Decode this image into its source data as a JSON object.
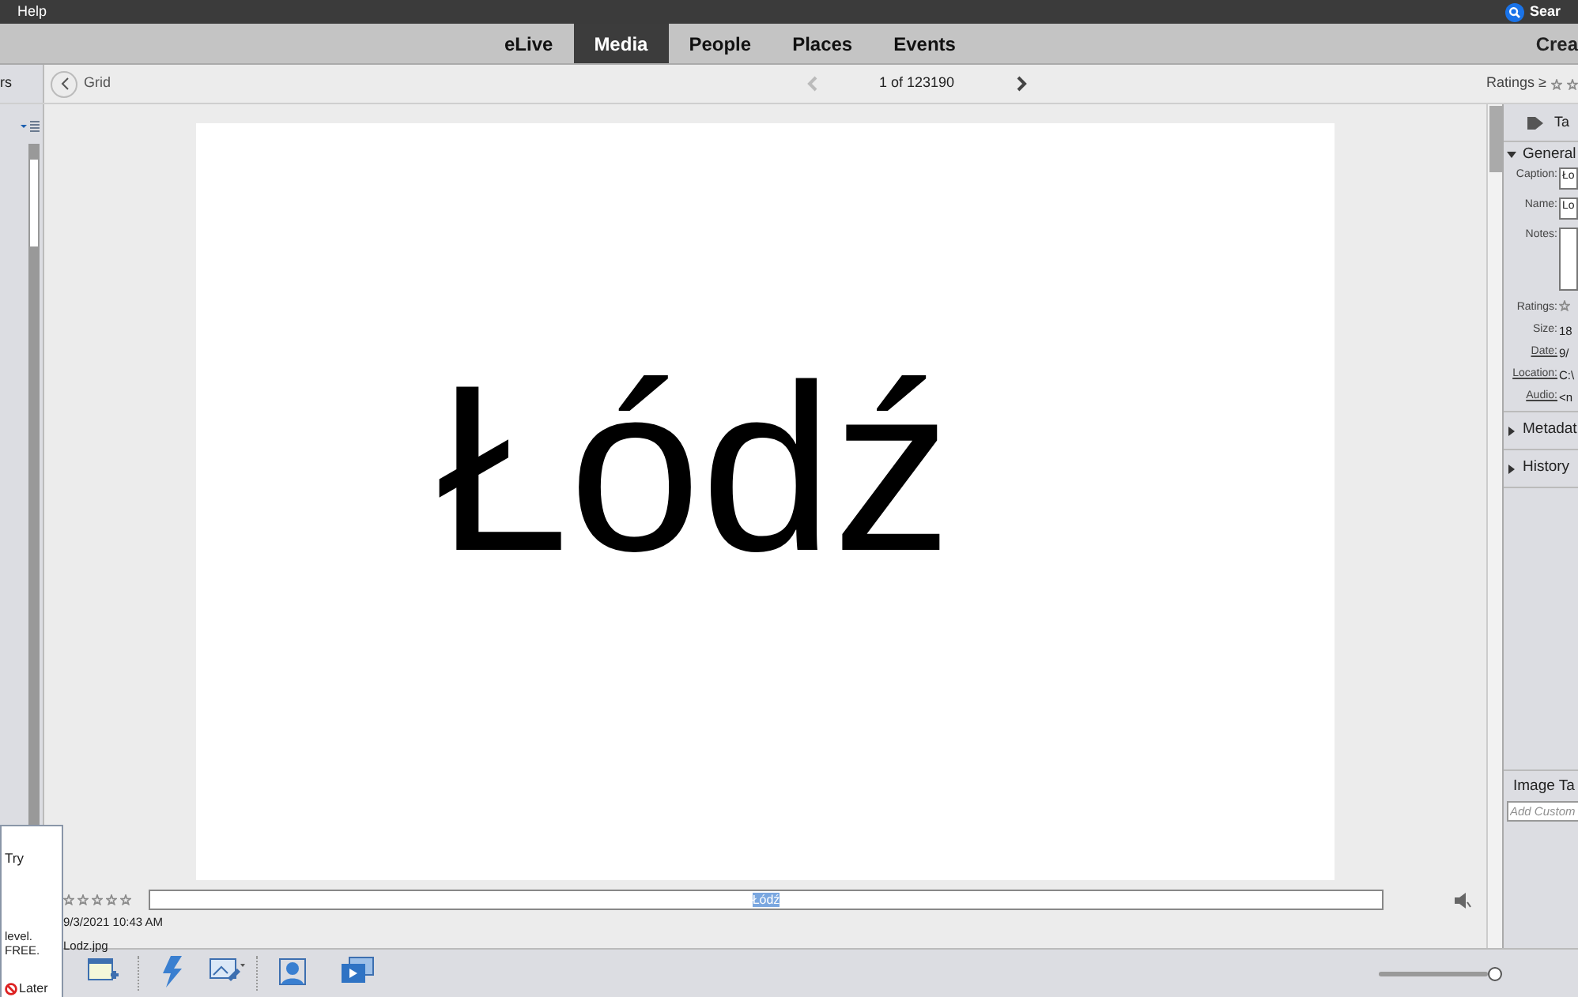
{
  "menu_bar": {
    "items": [
      "Help"
    ],
    "search": "Sear"
  },
  "tabs": [
    {
      "label": "eLive",
      "selected": false
    },
    {
      "label": "Media",
      "selected": true
    },
    {
      "label": "People",
      "selected": false
    },
    {
      "label": "Places",
      "selected": false
    },
    {
      "label": "Events",
      "selected": false
    }
  ],
  "create_label": "Crea",
  "left_panel": {
    "title": "rs"
  },
  "view_bar": {
    "back_label": "Grid",
    "prev_disabled": true,
    "next_disabled": false,
    "counter": "1 of 123190",
    "ratings_label": "Ratings ≥"
  },
  "media": {
    "image_text": "Łódź",
    "stars": 0,
    "caption": "Łódź",
    "date": "9/3/2021 10:43 AM",
    "filename": "Lodz.jpg"
  },
  "popup": {
    "lines": [
      "Try",
      "level.",
      "FREE."
    ],
    "later": "Later"
  },
  "info_panel": {
    "tags_label": "Ta",
    "general": {
      "title": "General",
      "expanded": true
    },
    "fields": [
      {
        "label": "Caption:",
        "value": "Ło",
        "kind": "input",
        "link": false
      },
      {
        "label": "Name:",
        "value": "Lo",
        "kind": "input",
        "link": false
      },
      {
        "label": "Notes:",
        "kind": "textarea",
        "link": false
      },
      {
        "label": "Ratings:",
        "kind": "stars",
        "link": false
      },
      {
        "label": "Size:",
        "value": "18",
        "kind": "text",
        "link": false
      },
      {
        "label": "Date:",
        "value": "9/",
        "kind": "text",
        "link": true
      },
      {
        "label": "Location:",
        "value": "C:\\",
        "kind": "text",
        "link": true
      },
      {
        "label": "Audio:",
        "value": "<n",
        "kind": "text",
        "link": true
      }
    ],
    "sections": [
      {
        "title": "Metadat",
        "expanded": false
      },
      {
        "title": "History",
        "expanded": false
      }
    ],
    "image_tags": {
      "title": "Image Ta",
      "placeholder": "Add Custom"
    }
  },
  "zoom_slider": {
    "level": 1.0
  }
}
